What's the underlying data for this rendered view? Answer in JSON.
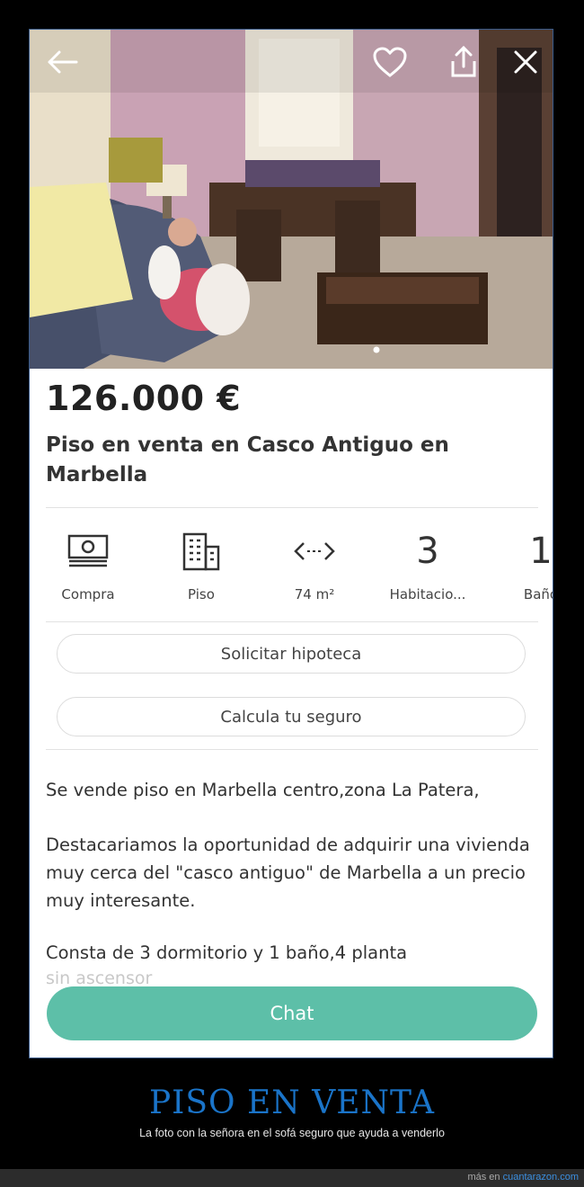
{
  "listing": {
    "price": "126.000 €",
    "title": "Piso en venta en Casco Antiguo en Marbella"
  },
  "features": [
    {
      "icon": "banknote-icon",
      "label": "Compra"
    },
    {
      "icon": "building-icon",
      "label": "Piso"
    },
    {
      "icon": "area-arrows-icon",
      "label": "74 m²"
    },
    {
      "value": "3",
      "label": "Habitacio..."
    },
    {
      "value": "1",
      "label": "Baño"
    }
  ],
  "actions": {
    "mortgage": "Solicitar hipoteca",
    "insurance": "Calcula tu seguro",
    "chat": "Chat"
  },
  "description": {
    "p1": "Se vende piso en Marbella centro,zona La Patera,",
    "p2": "Destacariamos la oportunidad de adquirir una vivienda muy cerca del \"casco antiguo\" de Marbella a un precio muy interesante.",
    "p3": "Consta de 3 dormitorio y 1 baño,4 planta",
    "p4_faded": "sin ascensor"
  },
  "caption": {
    "title": "PISO EN VENTA",
    "subtitle": "La foto con la señora en el sofá seguro que ayuda a venderlo"
  },
  "footer": {
    "prefix": "más en",
    "site": "cuantarazon.com"
  },
  "colors": {
    "chat_button": "#5dbfa8",
    "caption_title": "#1a74c9",
    "link": "#3b8fe0"
  }
}
